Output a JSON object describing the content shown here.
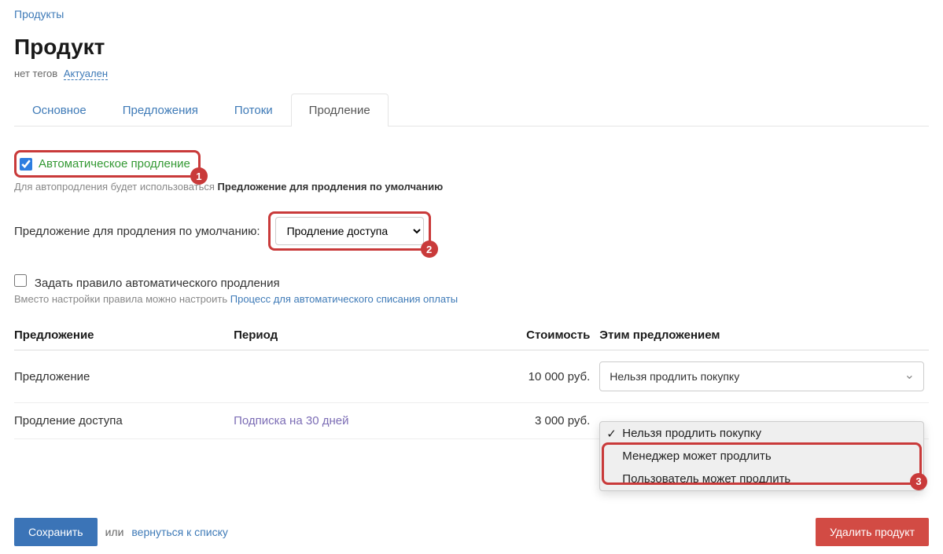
{
  "breadcrumb": {
    "products": "Продукты"
  },
  "title": "Продукт",
  "tags": {
    "none": "нет тегов",
    "actual": "Актуален"
  },
  "tabs": {
    "main": "Основное",
    "offers": "Предложения",
    "streams": "Потоки",
    "renewal": "Продление"
  },
  "auto_renewal": {
    "label": "Автоматическое продление",
    "hint_prefix": "Для автопродления будет использоваться ",
    "hint_bold": "Предложение для продления по умолчанию"
  },
  "default_offer": {
    "label": "Предложение для продления по умолчанию:",
    "value": "Продление доступа"
  },
  "rule": {
    "label": "Задать правило автоматического продления",
    "hint_prefix": "Вместо настройки правила можно настроить ",
    "hint_link": "Процесс для автоматического списания оплаты"
  },
  "table": {
    "headers": {
      "offer": "Предложение",
      "period": "Период",
      "cost": "Стоимость",
      "action": "Этим предложением"
    },
    "rows": [
      {
        "offer": "Предложение",
        "period": "",
        "cost": "10 000 руб.",
        "action": "Нельзя продлить покупку"
      },
      {
        "offer": "Продление доступа",
        "period": "Подписка на 30 дней",
        "cost": "3 000 руб.",
        "action": ""
      }
    ]
  },
  "dropdown": {
    "options": [
      "Нельзя продлить покупку",
      "Менеджер может продлить",
      "Пользователь может продлить"
    ]
  },
  "footer": {
    "save": "Сохранить",
    "or": "или",
    "back": "вернуться к списку",
    "delete": "Удалить продукт"
  },
  "annotations": {
    "n1": "1",
    "n2": "2",
    "n3": "3"
  }
}
